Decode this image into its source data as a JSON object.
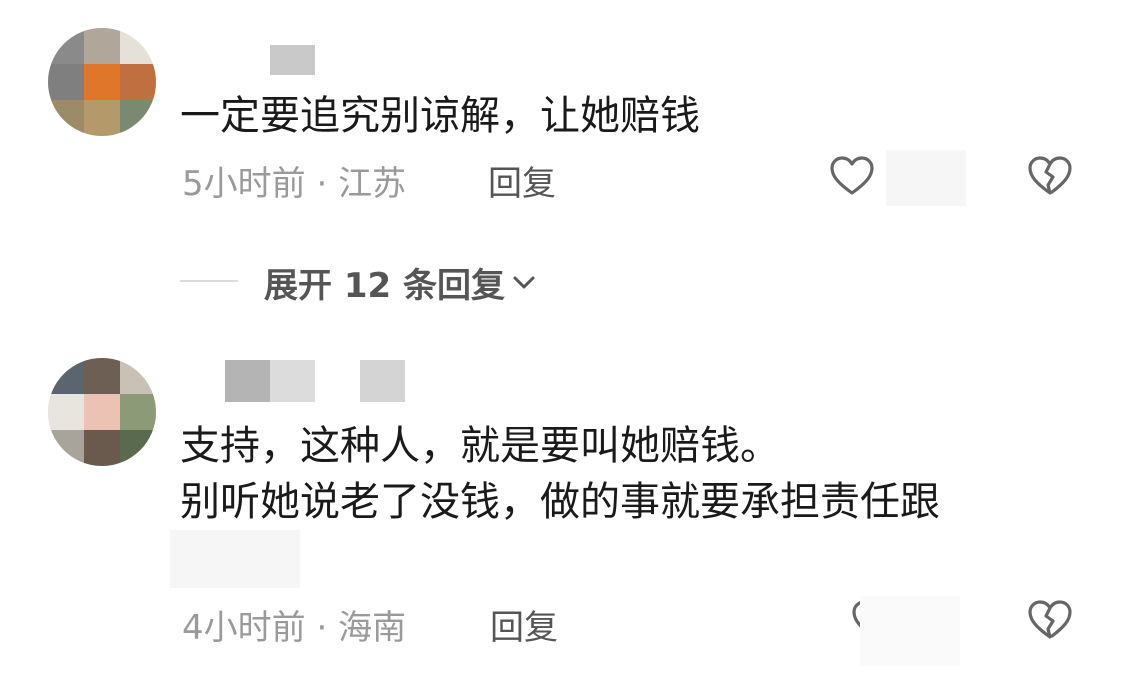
{
  "comments": [
    {
      "text_lines": [
        "一定要追究别谅解，让她赔钱"
      ],
      "time": "5小时前",
      "location": "江苏",
      "separator": " · ",
      "reply_label": "回复"
    },
    {
      "text_lines": [
        "支持，这种人，就是要叫她赔钱。",
        " 别听她说老了没钱，做的事就要承担责任跟"
      ],
      "time": "4小时前",
      "location": "海南",
      "separator": " · ",
      "reply_label": "回复"
    }
  ],
  "expand": {
    "label": "展开 12 条回复"
  },
  "icons": {
    "like": "heart-outline-icon",
    "dislike": "broken-heart-icon",
    "expand_chevron": "chevron-down-icon"
  },
  "colors": {
    "text": "#1a1a1a",
    "meta": "#9a9a9a",
    "reply": "#555555",
    "icon": "#666666"
  }
}
